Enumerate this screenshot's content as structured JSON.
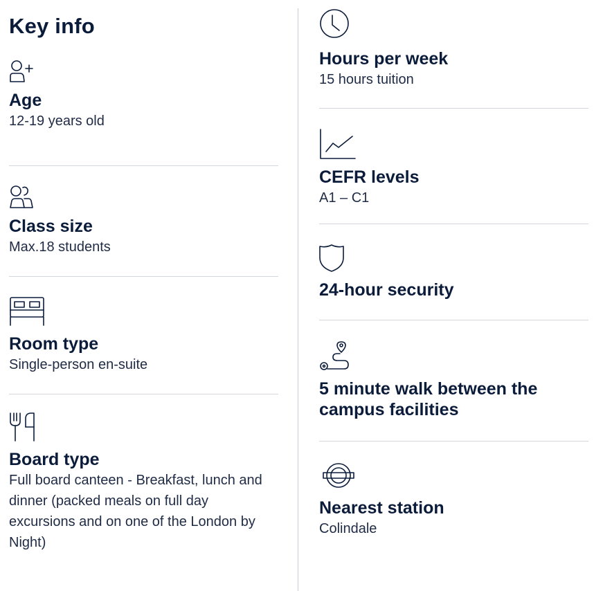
{
  "title": "Key info",
  "left_items": [
    {
      "icon": "person-plus-icon",
      "heading": "Age",
      "value": "12-19 years old"
    },
    {
      "icon": "people-icon",
      "heading": "Class size",
      "value": "Max.18 students"
    },
    {
      "icon": "bed-icon",
      "heading": "Room type",
      "value": "Single-person en-suite"
    },
    {
      "icon": "fork-knife-icon",
      "heading": "Board type",
      "value": "Full board canteen - Breakfast, lunch and dinner (packed meals on full day excursions and on one of the London by Night)"
    }
  ],
  "right_items": [
    {
      "icon": "clock-icon",
      "heading": "Hours per week",
      "value": "15 hours tuition"
    },
    {
      "icon": "chart-line-icon",
      "heading": "CEFR levels",
      "value": "A1 – C1"
    },
    {
      "icon": "shield-icon",
      "heading": "24-hour security",
      "value": ""
    },
    {
      "icon": "route-pin-icon",
      "heading": "5 minute walk between the campus facilities",
      "value": ""
    },
    {
      "icon": "underground-icon",
      "heading": "Nearest station",
      "value": "Colindale"
    }
  ]
}
